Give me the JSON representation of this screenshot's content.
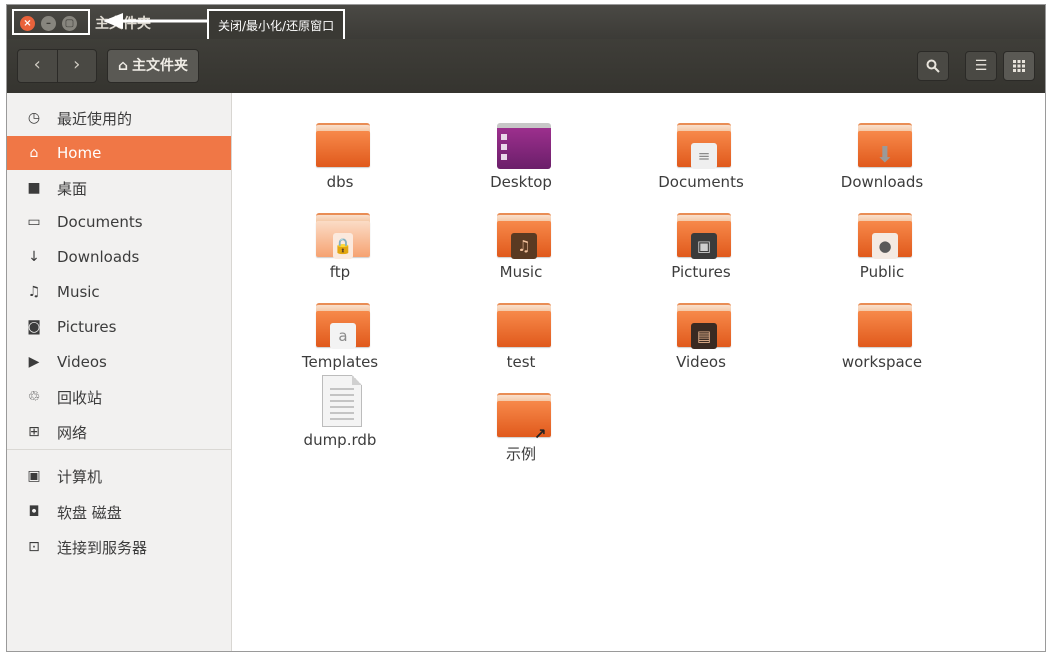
{
  "window": {
    "title": "主文件夹",
    "tooltip": "关闭/最小化/还原窗口",
    "buttons": {
      "close": "×",
      "minimize": "–",
      "maximize": "▢"
    }
  },
  "toolbar": {
    "back": "‹",
    "forward": "›",
    "path_icon": "⌂",
    "path_label": "主文件夹",
    "search_icon": "🔍",
    "list_view_icon": "☰",
    "grid_view_icon": "⋮⋮"
  },
  "sidebar": {
    "items": [
      {
        "label": "最近使用的",
        "icon": "recent-icon",
        "glyph": "◷"
      },
      {
        "label": "Home",
        "icon": "home-icon",
        "glyph": "⌂",
        "active": true
      },
      {
        "label": "桌面",
        "icon": "desktop-folder-icon",
        "glyph": "■"
      },
      {
        "label": "Documents",
        "icon": "document-icon",
        "glyph": "▭"
      },
      {
        "label": "Downloads",
        "icon": "download-icon",
        "glyph": "↓"
      },
      {
        "label": "Music",
        "icon": "music-icon",
        "glyph": "♫"
      },
      {
        "label": "Pictures",
        "icon": "camera-icon",
        "glyph": "◙"
      },
      {
        "label": "Videos",
        "icon": "video-icon",
        "glyph": "▶"
      },
      {
        "label": "回收站",
        "icon": "trash-icon",
        "glyph": "♲"
      },
      {
        "label": "网络",
        "icon": "network-icon",
        "glyph": "⊞"
      },
      {
        "label": "计算机",
        "icon": "computer-icon",
        "glyph": "▣"
      },
      {
        "label": "软盘 磁盘",
        "icon": "floppy-icon",
        "glyph": "◘"
      },
      {
        "label": "连接到服务器",
        "icon": "server-icon",
        "glyph": "⊡"
      }
    ]
  },
  "files": [
    {
      "label": "dbs",
      "kind": "folder"
    },
    {
      "label": "Desktop",
      "kind": "desktop"
    },
    {
      "label": "Documents",
      "kind": "folder-documents"
    },
    {
      "label": "Downloads",
      "kind": "folder-downloads"
    },
    {
      "label": "ftp",
      "kind": "folder-locked"
    },
    {
      "label": "Music",
      "kind": "folder-music"
    },
    {
      "label": "Pictures",
      "kind": "folder-pictures"
    },
    {
      "label": "Public",
      "kind": "folder-public"
    },
    {
      "label": "Templates",
      "kind": "folder-templates"
    },
    {
      "label": "test",
      "kind": "folder"
    },
    {
      "label": "Videos",
      "kind": "folder-videos"
    },
    {
      "label": "workspace",
      "kind": "folder"
    },
    {
      "label": "dump.rdb",
      "kind": "file"
    },
    {
      "label": "示例",
      "kind": "folder-link"
    }
  ],
  "colors": {
    "accent": "#f07746",
    "titlebar": "#3c3b37",
    "sidebar": "#f2f1f0"
  }
}
